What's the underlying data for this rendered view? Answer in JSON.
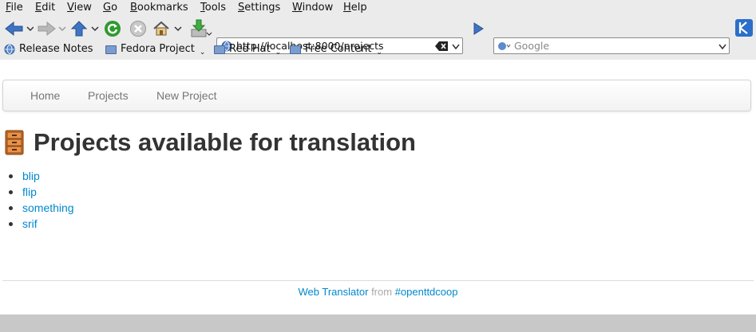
{
  "menu": [
    "File",
    "Edit",
    "View",
    "Go",
    "Bookmarks",
    "Tools",
    "Settings",
    "Window",
    "Help"
  ],
  "toolbar": {
    "url": "http://localhost:8000/projects",
    "search_placeholder": "Google"
  },
  "bookmarks": [
    {
      "label": "Release Notes"
    },
    {
      "label": "Fedora Project"
    },
    {
      "label": "Red Hat"
    },
    {
      "label": "Free Content"
    }
  ],
  "nav": {
    "home": "Home",
    "projects": "Projects",
    "new_project": "New Project"
  },
  "heading": "Projects available for translation",
  "projects": [
    "blip",
    "flip",
    "something",
    "srif"
  ],
  "footer": {
    "app": "Web Translator",
    "from": "from",
    "org": "#openttdcoop"
  },
  "colors": {
    "link": "#0088cc",
    "heading": "#333333",
    "chrome": "#ebebeb"
  }
}
